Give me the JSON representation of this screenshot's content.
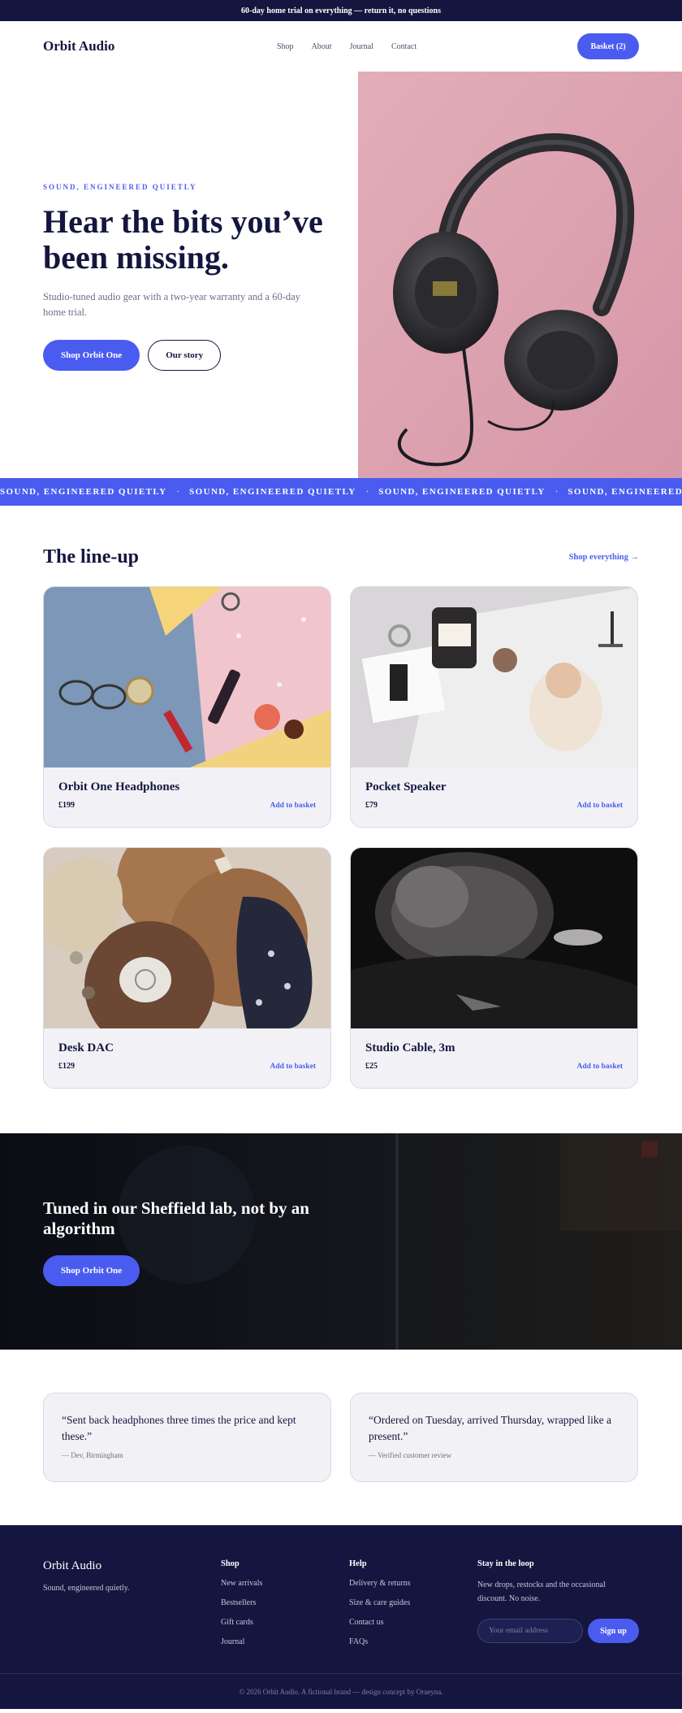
{
  "announcement": "60-day home trial on everything — return it, no questions",
  "nav": {
    "logo": "Orbit Audio",
    "links": [
      "Shop",
      "About",
      "Journal",
      "Contact"
    ],
    "basket_label": "Basket (2)"
  },
  "hero": {
    "eyebrow": "SOUND, ENGINEERED QUIETLY",
    "title": "Hear the bits you’ve been missing.",
    "subtitle": "Studio-tuned audio gear with a two-year warranty and a 60-day home trial.",
    "primary_cta": "Shop Orbit One",
    "secondary_cta": "Our story",
    "image": "headphones-on-pink-photo"
  },
  "ticker": {
    "text": "SOUND, ENGINEERED QUIETLY",
    "separator": "·"
  },
  "lineup": {
    "title": "The line-up",
    "shop_all": "Shop everything →",
    "products": [
      {
        "name": "Orbit One Headphones",
        "price": "£199",
        "cta": "Add to basket",
        "image": "flatlay-denim-accessories-photo"
      },
      {
        "name": "Pocket Speaker",
        "price": "£79",
        "cta": "Add to basket",
        "image": "flatlay-magazine-candle-photo"
      },
      {
        "name": "Desk DAC",
        "price": "£129",
        "cta": "Add to basket",
        "image": "flatlay-knitwear-wood-photo"
      },
      {
        "name": "Studio Cable, 3m",
        "price": "£25",
        "cta": "Add to basket",
        "image": "dark-speaker-photo"
      }
    ]
  },
  "lab": {
    "title": "Tuned in our Sheffield lab, not by an algorithm",
    "cta": "Shop Orbit One",
    "image": "dark-studio-photo"
  },
  "reviews": [
    {
      "quote": "“Sent back headphones three times the price and kept these.”",
      "author": "— Dev, Birmingham"
    },
    {
      "quote": "“Ordered on Tuesday, arrived Thursday, wrapped like a present.”",
      "author": "— Verified customer review"
    }
  ],
  "footer": {
    "logo": "Orbit Audio",
    "tagline": "Sound, engineered quietly.",
    "shop": {
      "title": "Shop",
      "links": [
        "New arrivals",
        "Bestsellers",
        "Gift cards",
        "Journal"
      ]
    },
    "help": {
      "title": "Help",
      "links": [
        "Delivery & returns",
        "Size & care guides",
        "Contact us",
        "FAQs"
      ]
    },
    "newsletter": {
      "title": "Stay in the loop",
      "text": "New drops, restocks and the occasional discount. No noise.",
      "placeholder": "Your email address",
      "button": "Sign up"
    },
    "copyright": "© 2026 Orbit Audio. A fictional brand — design concept by Oraeyna."
  },
  "colors": {
    "navy": "#14163f",
    "accent": "#4a5cf0",
    "card_bg": "#f2f2f6",
    "hero_pink": "#dba3b0"
  }
}
